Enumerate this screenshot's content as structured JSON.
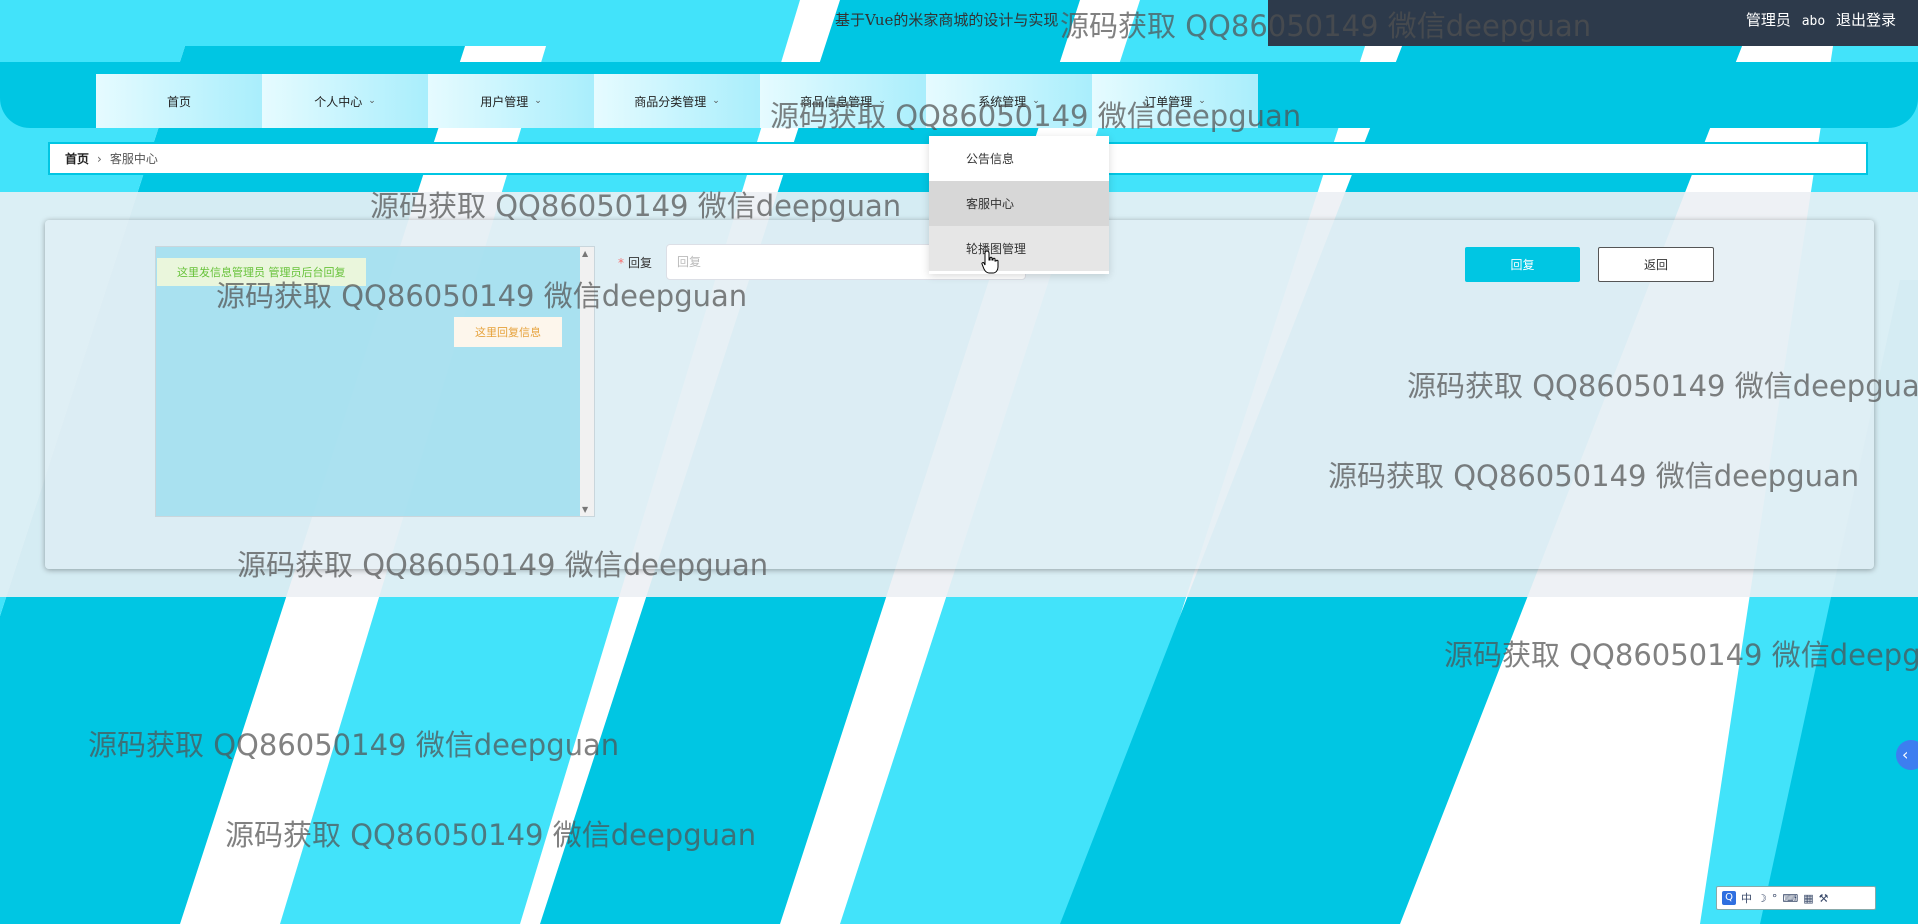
{
  "colors": {
    "accent": "#00c6e3",
    "light_accent": "#42e3fa",
    "topbar_dark": "#2d3a4b",
    "reply_bubble_text": "#e6a23c",
    "user_bubble_text": "#67c23a"
  },
  "header": {
    "site_title": "基于Vue的米家商城的设计与实现",
    "user_role": "管理员",
    "username": "abo",
    "logout_label": "退出登录"
  },
  "nav": {
    "items": [
      {
        "label": "首页",
        "has_dropdown": false
      },
      {
        "label": "个人中心",
        "has_dropdown": true
      },
      {
        "label": "用户管理",
        "has_dropdown": true
      },
      {
        "label": "商品分类管理",
        "has_dropdown": true
      },
      {
        "label": "商品信息管理",
        "has_dropdown": true
      },
      {
        "label": "系统管理",
        "has_dropdown": true
      },
      {
        "label": "订单管理",
        "has_dropdown": true
      }
    ],
    "open_dropdown": {
      "parent": "系统管理",
      "items": [
        {
          "label": "公告信息"
        },
        {
          "label": "客服中心"
        },
        {
          "label": "轮播图管理"
        }
      ]
    }
  },
  "breadcrumb": {
    "home": "首页",
    "current": "客服中心"
  },
  "chat": {
    "user_message": "这里发信息管理员  管理员后台回复",
    "admin_reply": "这里回复信息"
  },
  "form": {
    "reply_label": "回复",
    "reply_placeholder": "回复",
    "reply_value": "",
    "submit_label": "回复",
    "back_label": "返回"
  },
  "watermark_text": "源码获取 QQ86050149 微信deepguan",
  "ime_bar": {
    "mode_label": "中",
    "logo": "Q"
  }
}
